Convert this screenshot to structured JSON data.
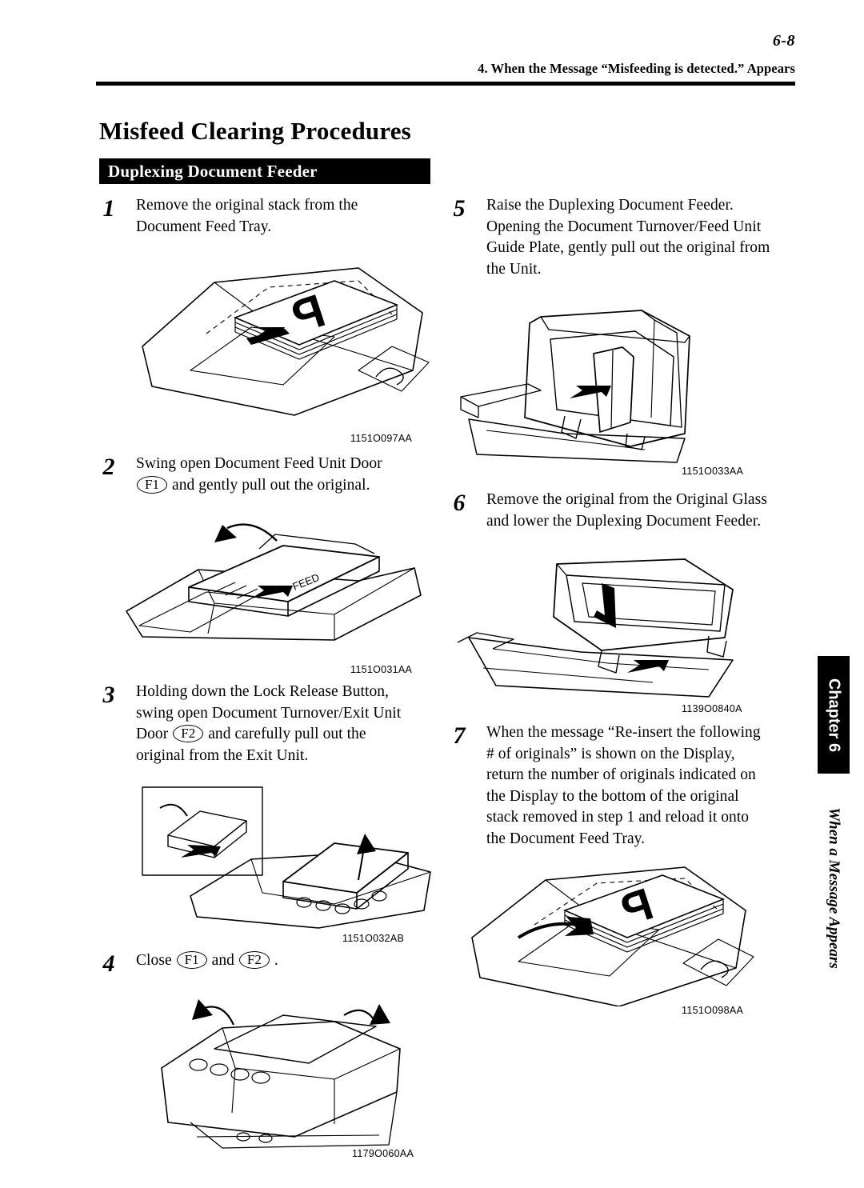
{
  "page": {
    "number": "6-8",
    "running_head": "4. When the Message “Misfeeding is detected.” Appears",
    "title": "Misfeed Clearing Procedures",
    "section": "Duplexing Document Feeder"
  },
  "chapter_tab": {
    "label": "Chapter 6",
    "subtitle": "When a Message Appears"
  },
  "steps": {
    "s1": {
      "num": "1",
      "lines": [
        "Remove the original stack from the",
        "Document Feed Tray."
      ]
    },
    "s2": {
      "num": "2",
      "line1": "Swing open Document Feed Unit Door",
      "key": "F1",
      "line2": "and gently pull out the original."
    },
    "s3": {
      "num": "3",
      "line1": "Holding down the Lock Release Button,",
      "line2": "swing open Document Turnover/Exit Unit",
      "line3a": "Door",
      "key": "F2",
      "line3b": "and carefully pull out the",
      "line4": "original from the Exit Unit."
    },
    "s4": {
      "num": "4",
      "lead": "Close",
      "key1": "F1",
      "mid": "and",
      "key2": "F2",
      "tail": "."
    },
    "s5": {
      "num": "5",
      "lines": [
        "Raise the Duplexing Document Feeder.",
        "Opening the Document Turnover/Feed Unit",
        "Guide Plate, gently pull out the original from",
        "the Unit."
      ]
    },
    "s6": {
      "num": "6",
      "lines": [
        "Remove the original from the Original Glass",
        "and lower the Duplexing Document Feeder."
      ]
    },
    "s7": {
      "num": "7",
      "lines": [
        "When the message “Re-insert the following",
        "# of originals” is shown on the Display,",
        "return the number of originals indicated on",
        "the Display to the bottom of the original",
        "stack removed in step 1 and reload it onto",
        "the Document Feed Tray."
      ]
    }
  },
  "figures": {
    "f1": {
      "code": "1151O097AA",
      "caption": "Document Feed Tray with original stack"
    },
    "f2": {
      "code": "1151O031AA",
      "caption": "Document Feed Unit Door F1 opened"
    },
    "f3": {
      "code": "1151O032AB",
      "caption": "Document Turnover/Exit Unit Door F2 opened"
    },
    "f4": {
      "code": "1179O060AA",
      "caption": "Closing doors F1 and F2"
    },
    "f5": {
      "code": "1151O033AA",
      "caption": "Duplexing Document Feeder raised"
    },
    "f6": {
      "code": "1139O0840A",
      "caption": "Original Glass with feeder lowered"
    },
    "f7": {
      "code": "1151O098AA",
      "caption": "Reloading originals onto Document Feed Tray"
    }
  }
}
